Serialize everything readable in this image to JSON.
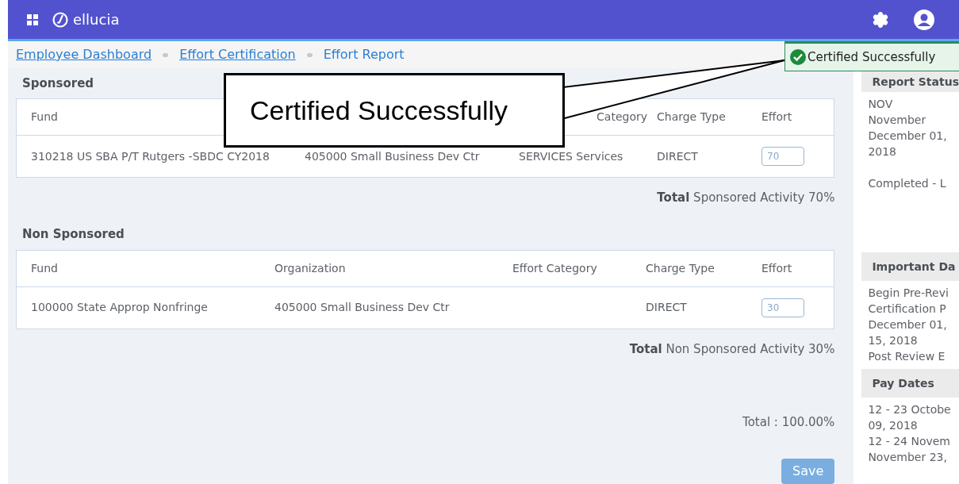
{
  "header": {
    "brand": "ellucia"
  },
  "breadcrumbs": [
    {
      "label": "Employee Dashboard",
      "current": false
    },
    {
      "label": "Effort Certification",
      "current": false
    },
    {
      "label": "Effort Report",
      "current": true
    }
  ],
  "sections": [
    {
      "title": "Sponsored",
      "columns": [
        "Fund",
        "Category",
        "Charge Type",
        "Effort"
      ],
      "rows": [
        {
          "fund": "310218 US SBA P/T Rutgers -SBDC CY2018",
          "organization": "405000 Small Business Dev Ctr",
          "category": "SERVICES Services",
          "charge": "DIRECT",
          "effort": "70"
        }
      ],
      "total_label": "Total",
      "total_text": "Sponsored Activity 70%"
    },
    {
      "title": "Non Sponsored",
      "columns": [
        "Fund",
        "Organization",
        "Effort Category",
        "Charge Type",
        "Effort"
      ],
      "rows": [
        {
          "fund": "100000 State Approp Nonfringe",
          "organization": "405000 Small Business Dev Ctr",
          "charge": "DIRECT",
          "effort": "30"
        }
      ],
      "total_label": "Total",
      "total_text": "Non Sponsored Activity 30%"
    }
  ],
  "grand_total": "Total : 100.00%",
  "save_button": {
    "label": "Save",
    "disabled": true
  },
  "sidebar": [
    {
      "title": "Report Status",
      "lines": [
        "NOV",
        "November",
        "December 01,",
        "2018"
      ],
      "status": "Completed - L"
    },
    {
      "title": "Important Da",
      "lines": [
        "Begin Pre-Revi",
        "Certification P",
        "December 01,",
        "15, 2018",
        "Post Review E"
      ]
    },
    {
      "title": "Pay Dates",
      "lines": [
        "12 - 23 Octobe",
        "09, 2018",
        "12 - 24 Novem",
        "November 23,"
      ]
    }
  ],
  "toast": {
    "message": "Certified Successfully"
  },
  "callout": {
    "text": "Certified Successfully"
  }
}
